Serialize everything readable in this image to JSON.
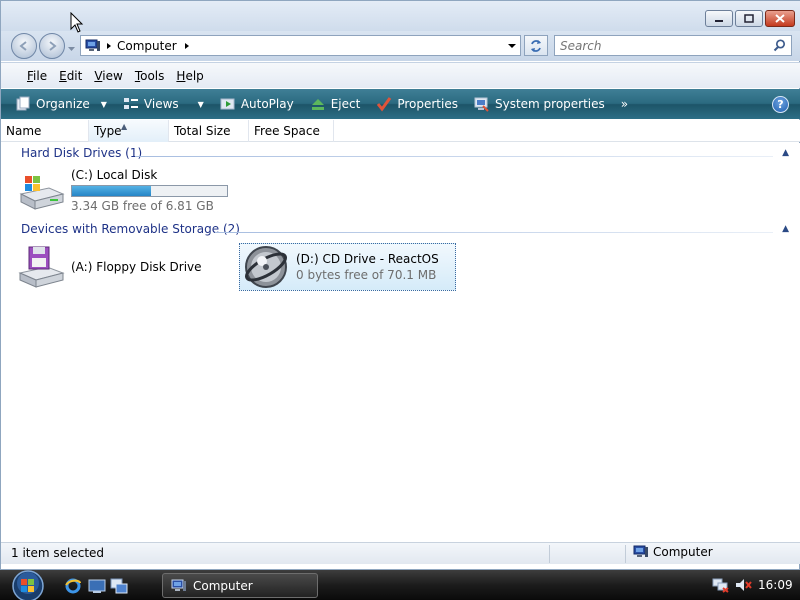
{
  "window": {
    "title": "Computer"
  },
  "address": {
    "location": "Computer",
    "search_placeholder": "Search"
  },
  "menu": {
    "items": [
      {
        "label_pre": "",
        "label_u": "F",
        "label_post": "ile"
      },
      {
        "label_pre": "",
        "label_u": "E",
        "label_post": "dit"
      },
      {
        "label_pre": "",
        "label_u": "V",
        "label_post": "iew"
      },
      {
        "label_pre": "",
        "label_u": "T",
        "label_post": "ools"
      },
      {
        "label_pre": "",
        "label_u": "H",
        "label_post": "elp"
      }
    ]
  },
  "commandbar": {
    "organize": "Organize",
    "views": "Views",
    "autoplay": "AutoPlay",
    "eject": "Eject",
    "properties": "Properties",
    "system_properties": "System properties",
    "more": "»",
    "help": "?"
  },
  "columns": [
    {
      "label": "Name"
    },
    {
      "label": "Type"
    },
    {
      "label": "Total Size"
    },
    {
      "label": "Free Space"
    }
  ],
  "groups": {
    "hdd": {
      "header": "Hard Disk Drives (1)",
      "drives": [
        {
          "name": "(C:) Local Disk",
          "sub": "3.34 GB free of 6.81 GB",
          "used_fraction": 0.51
        }
      ]
    },
    "removable": {
      "header": "Devices with Removable Storage (2)",
      "drives": [
        {
          "name": "(A:) Floppy Disk Drive"
        },
        {
          "name": "(D:) CD Drive - ReactOS",
          "sub": "0 bytes free of 70.1 MB"
        }
      ]
    }
  },
  "statusbar": {
    "left": "1 item selected",
    "right": "Computer"
  },
  "taskbar": {
    "task_label": "Computer",
    "clock": "16:09"
  },
  "colors": {
    "accent": "#1e3287",
    "cmdbar": "#2b6a80",
    "selection": "#d5ebf9"
  }
}
